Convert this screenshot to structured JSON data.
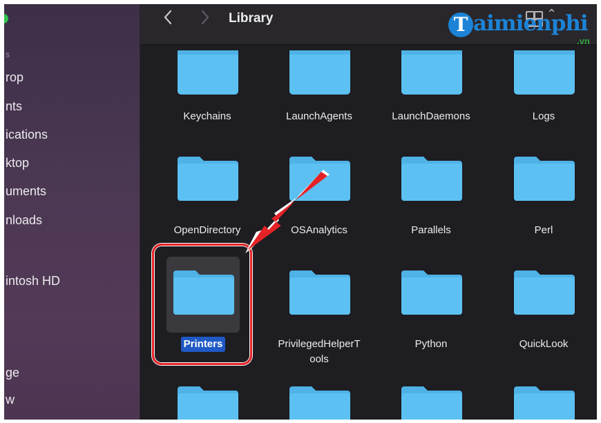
{
  "window": {
    "title": "Library"
  },
  "toolbar": {
    "back_icon": "chevron-left-icon",
    "forward_icon": "chevron-right-icon",
    "view_icon": "grid-view-icon"
  },
  "sidebar": {
    "section_header": "s",
    "items": [
      {
        "label": "rop",
        "y": 0
      },
      {
        "label": "nts"
      },
      {
        "label": "ications"
      },
      {
        "label": "ktop"
      },
      {
        "label": "uments"
      },
      {
        "label": "nloads"
      },
      {
        "label": "intosh HD"
      },
      {
        "label": "ge"
      },
      {
        "label": "w"
      }
    ]
  },
  "logo": {
    "initial": "T",
    "text": "aimienphi",
    "suffix": ".vn"
  },
  "folders": [
    {
      "name": "Keychains"
    },
    {
      "name": "LaunchAgents"
    },
    {
      "name": "LaunchDaemons"
    },
    {
      "name": "Logs"
    },
    {
      "name": "OpenDirectory"
    },
    {
      "name": "OSAnalytics"
    },
    {
      "name": "Parallels"
    },
    {
      "name": "Perl"
    },
    {
      "name": "Printers",
      "selected": true
    },
    {
      "name": "PrivilegedHelperTools",
      "line1": "PrivilegedHelperT",
      "line2": "ools"
    },
    {
      "name": "Python"
    },
    {
      "name": "QuickLook"
    }
  ],
  "colors": {
    "folder": "#5cc1f2",
    "folder_tab": "#4fb2e6",
    "accent": "#e52327",
    "selection": "#1f59c5"
  }
}
